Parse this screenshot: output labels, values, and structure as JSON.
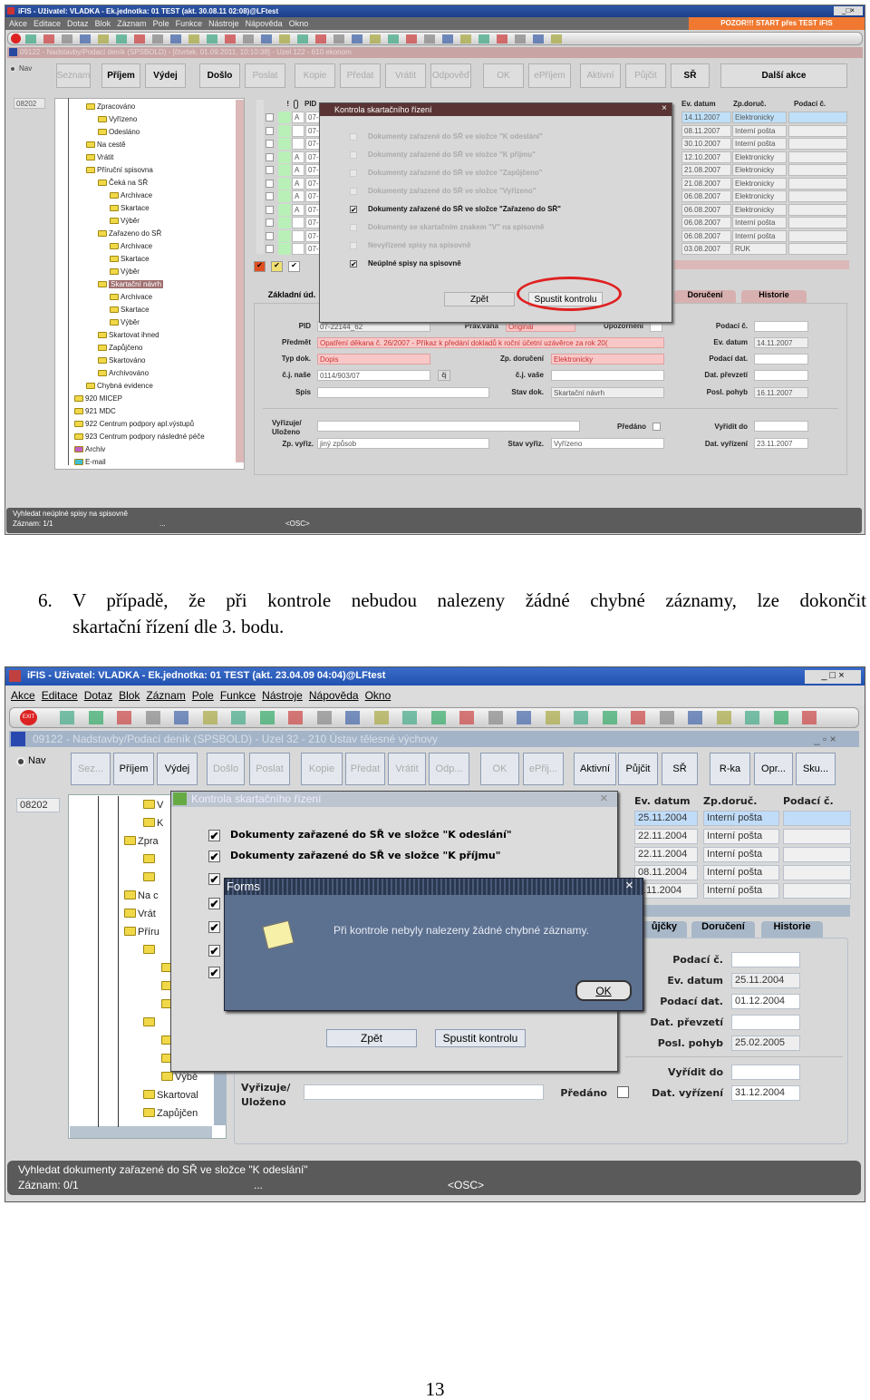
{
  "shot1": {
    "title": "iFIS - Uživatel: VLADKA - Ek.jednotka: 01 TEST (akt. 30.08.11 02:08)@LFtest",
    "menu": [
      "Akce",
      "Editace",
      "Dotaz",
      "Blok",
      "Záznam",
      "Pole",
      "Funkce",
      "Nástroje",
      "Nápověda",
      "Okno"
    ],
    "banner": "POZOR!!!  START přes TEST iFIS",
    "inner_title": "09122 - Nadstavby/Podací deník (SPSBOLD) - [čtvrtek, 01.09.2011, 10:10:38] - Uzel 122 - 610 ekonom",
    "nav_label": "Nav",
    "buttons": [
      {
        "label": "Seznam",
        "enabled": false
      },
      {
        "label": "Příjem",
        "enabled": true
      },
      {
        "label": "Výdej",
        "enabled": true
      },
      {
        "label": "Došlo",
        "enabled": true
      },
      {
        "label": "Poslat",
        "enabled": false
      },
      {
        "label": "Kopie",
        "enabled": false
      },
      {
        "label": "Předat",
        "enabled": false
      },
      {
        "label": "Vrátit",
        "enabled": false
      },
      {
        "label": "Odpověď",
        "enabled": false
      },
      {
        "label": "OK",
        "enabled": false
      },
      {
        "label": "ePříjem",
        "enabled": false
      },
      {
        "label": "Aktivní",
        "enabled": false
      },
      {
        "label": "Půjčit",
        "enabled": false
      },
      {
        "label": "SŘ",
        "enabled": true
      },
      {
        "label": "Další akce",
        "enabled": true
      }
    ],
    "record_field": "08202",
    "tree": [
      {
        "label": "Zpracováno",
        "level": 2
      },
      {
        "label": "Vyřízeno",
        "level": 3
      },
      {
        "label": "Odesláno",
        "level": 3
      },
      {
        "label": "Na cestě",
        "level": 2
      },
      {
        "label": "Vrátit",
        "level": 2
      },
      {
        "label": "Příruční spisovna",
        "level": 2
      },
      {
        "label": "Čeká na SŘ",
        "level": 3
      },
      {
        "label": "Archivace",
        "level": 4
      },
      {
        "label": "Skartace",
        "level": 4
      },
      {
        "label": "Výběr",
        "level": 4
      },
      {
        "label": "Zařazeno do SŘ",
        "level": 3
      },
      {
        "label": "Archivace",
        "level": 4
      },
      {
        "label": "Skartace",
        "level": 4
      },
      {
        "label": "Výběr",
        "level": 4
      },
      {
        "label": "Skartační návrh",
        "level": 3,
        "selected": true
      },
      {
        "label": "Archivace",
        "level": 4
      },
      {
        "label": "Skartace",
        "level": 4
      },
      {
        "label": "Výběr",
        "level": 4
      },
      {
        "label": "Skartovat ihned",
        "level": 3
      },
      {
        "label": "Zapůjčeno",
        "level": 3
      },
      {
        "label": "Skartováno",
        "level": 3
      },
      {
        "label": "Archivováno",
        "level": 3
      },
      {
        "label": "Chybná evidence",
        "level": 2
      },
      {
        "label": "920 MICEP",
        "level": 1
      },
      {
        "label": "921 MDC",
        "level": 1
      },
      {
        "label": "922 Centrum podpory apl.výstupů",
        "level": 1
      },
      {
        "label": "923 Centrum podpory následné péče",
        "level": 1
      },
      {
        "label": "Archiv",
        "level": 1,
        "color": "#c060c0"
      },
      {
        "label": "E-mail",
        "level": 1,
        "color": "#40c0d0"
      }
    ],
    "table": {
      "headers": {
        "excl": "!",
        "pid": "PID",
        "ev_datum": "Ev. datum",
        "zp_doruc": "Zp.doruč.",
        "podaci": "Podací č."
      },
      "rows": [
        {
          "flag": "A",
          "pid": "07-",
          "ev_datum": "14.11.2007",
          "zp_doruc": "Elektronicky",
          "selected": true
        },
        {
          "flag": "",
          "pid": "07-",
          "ev_datum": "08.11.2007",
          "zp_doruc": "Interní pošta"
        },
        {
          "flag": "",
          "pid": "07-",
          "ev_datum": "30.10.2007",
          "zp_doruc": "Interní pošta"
        },
        {
          "flag": "A",
          "pid": "07-",
          "ev_datum": "12.10.2007",
          "zp_doruc": "Elektronicky"
        },
        {
          "flag": "A",
          "pid": "07-",
          "ev_datum": "21.08.2007",
          "zp_doruc": "Elektronicky"
        },
        {
          "flag": "A",
          "pid": "07-",
          "ev_datum": "21.08.2007",
          "zp_doruc": "Elektronicky"
        },
        {
          "flag": "A",
          "pid": "07-",
          "ev_datum": "06.08.2007",
          "zp_doruc": "Elektronicky"
        },
        {
          "flag": "A",
          "pid": "07-",
          "ev_datum": "06.08.2007",
          "zp_doruc": "Elektronicky"
        },
        {
          "flag": "",
          "pid": "07-",
          "ev_datum": "06.08.2007",
          "zp_doruc": "Interní pošta"
        },
        {
          "flag": "",
          "pid": "07-",
          "ev_datum": "06.08.2007",
          "zp_doruc": "Interní pošta"
        },
        {
          "flag": "",
          "pid": "07-",
          "ev_datum": "03.08.2007",
          "zp_doruc": "RUK"
        }
      ]
    },
    "dialog": {
      "title": "Kontrola skartačního řízení",
      "options": [
        {
          "label": "Dokumenty zařazené do SŘ ve složce \"K odeslání\"",
          "checked": false,
          "enabled": false
        },
        {
          "label": "Dokumenty zařazené do SŘ ve složce \"K příjmu\"",
          "checked": false,
          "enabled": false
        },
        {
          "label": "Dokumenty zařazené do SŘ ve složce \"Zapůjčeno\"",
          "checked": false,
          "enabled": false
        },
        {
          "label": "Dokumenty zařazené do SŘ ve složce \"Vyřízeno\"",
          "checked": false,
          "enabled": false
        },
        {
          "label": "Dokumenty zařazené do SŘ ve složce \"Zařazeno do SŘ\"",
          "checked": true,
          "enabled": true
        },
        {
          "label": "Dokumenty se skartačním znakem \"V\" na spisovně",
          "checked": false,
          "enabled": false
        },
        {
          "label": "Nevyřízené spisy na spisovně",
          "checked": false,
          "enabled": false
        },
        {
          "label": "Neúplné spisy na spisovně",
          "checked": true,
          "enabled": true
        }
      ],
      "back": "Zpět",
      "run": "Spustit kontrolu",
      "highlight_color": "#e02020"
    },
    "tabs": [
      "Základní úd.",
      "Doručení",
      "Historie"
    ],
    "form": {
      "pid_label": "PID",
      "pid": "07-22144_62",
      "prav_vaha_label": "Práv.váha",
      "prav_vaha": "Originál",
      "upozorneni_label": "Upozornění",
      "predmet_label": "Předmět",
      "predmet": "Opatření děkana č. 26/2007 - Příkaz k předání dokladů k roční účetní uzávěrce za rok 20(",
      "typ_label": "Typ dok.",
      "typ": "Dopis",
      "zp_doruceni_label": "Zp. doručení",
      "zp_doruceni": "Elektronicky",
      "cj_nase_label": "č.j. naše",
      "cj_nase": "0114/903/07",
      "cj_button": "čj",
      "cj_vase_label": "č.j. vaše",
      "spis_label": "Spis",
      "stav_dok_label": "Stav dok.",
      "stav_dok": "Skartační návrh",
      "podaci_c_label": "Podací č.",
      "ev_datum_label": "Ev. datum",
      "ev_datum": "14.11.2007",
      "podaci_dat_label": "Podací dat.",
      "dat_prevzeti_label": "Dat. převzetí",
      "posl_pohyb_label": "Posl. pohyb",
      "posl_pohyb": "16.11.2007",
      "vyrizuje_label": "Vyřizuje/",
      "ulozeno_label": "Uloženo",
      "predano_label": "Předáno",
      "vyridit_do_label": "Vyřídit do",
      "zp_vyriz_label": "Zp. vyřiz.",
      "zp_vyriz": "jiný způsob",
      "stav_vyriz_label": "Stav vyřiz.",
      "stav_vyriz": "Vyřízeno",
      "dat_vyrizeni_label": "Dat. vyřízení",
      "dat_vyrizeni": "23.11.2007"
    },
    "status": {
      "message": "Vyhledat neúplné spisy na spisovně",
      "record": "Záznam: 1/1",
      "dots": "...",
      "osc": "<OSC>"
    }
  },
  "caption": {
    "number": "6.",
    "line1": "V případě, že při kontrole nebudou nalezeny žádné chybné záznamy, lze dokončit",
    "line2": "skartační řízení dle 3. bodu."
  },
  "shot2": {
    "title": "iFIS - Uživatel: VLADKA - Ek.jednotka: 01 TEST (akt. 23.04.09 04:04)@LFtest",
    "menu": [
      "Akce",
      "Editace",
      "Dotaz",
      "Blok",
      "Záznam",
      "Pole",
      "Funkce",
      "Nástroje",
      "Nápověda",
      "Okno"
    ],
    "inner_title": "09122 - Nadstavby/Podací deník (SPSBOLD) - Uzel 32 - 210 Ústav tělesné výchovy",
    "nav_label": "Nav",
    "buttons": [
      {
        "label": "Sez...",
        "enabled": false
      },
      {
        "label": "Příjem",
        "enabled": true
      },
      {
        "label": "Výdej",
        "enabled": true
      },
      {
        "label": "Došlo",
        "enabled": false
      },
      {
        "label": "Poslat",
        "enabled": false
      },
      {
        "label": "Kopie",
        "enabled": false
      },
      {
        "label": "Předat",
        "enabled": false
      },
      {
        "label": "Vrátit",
        "enabled": false
      },
      {
        "label": "Odp...",
        "enabled": false
      },
      {
        "label": "OK",
        "enabled": false
      },
      {
        "label": "ePřij...",
        "enabled": false
      },
      {
        "label": "Aktivní",
        "enabled": true
      },
      {
        "label": "Půjčit",
        "enabled": true
      },
      {
        "label": "SŘ",
        "enabled": true
      },
      {
        "label": "R-ka",
        "enabled": true
      },
      {
        "label": "Opr...",
        "enabled": true
      },
      {
        "label": "Sku...",
        "enabled": true
      }
    ],
    "record_field": "08202",
    "tree": [
      {
        "label": "V",
        "level": 3
      },
      {
        "label": "K",
        "level": 3
      },
      {
        "label": "Zpra",
        "level": 2
      },
      {
        "label": "",
        "level": 3
      },
      {
        "label": "",
        "level": 3
      },
      {
        "label": "Na c",
        "level": 2
      },
      {
        "label": "Vrát",
        "level": 2
      },
      {
        "label": "Příru",
        "level": 2
      },
      {
        "label": "",
        "level": 3
      },
      {
        "label": "",
        "level": 4
      },
      {
        "label": "",
        "level": 4
      },
      {
        "label": "",
        "level": 4
      },
      {
        "label": "",
        "level": 3
      },
      {
        "label": "",
        "level": 4
      },
      {
        "label": "",
        "level": 4
      },
      {
        "label": "Výbě",
        "level": 4
      },
      {
        "label": "Skartoval",
        "level": 3
      },
      {
        "label": "Zapůjčen",
        "level": 3
      }
    ],
    "table": {
      "headers": {
        "ev_datum": "Ev. datum",
        "zp_doruc": "Zp.doruč.",
        "podaci": "Podací č."
      },
      "rows": [
        {
          "ev_datum": "25.11.2004",
          "zp_doruc": "Interní pošta",
          "selected": true
        },
        {
          "ev_datum": "22.11.2004",
          "zp_doruc": "Interní pošta"
        },
        {
          "ev_datum": "22.11.2004",
          "zp_doruc": "Interní pošta"
        },
        {
          "ev_datum": "08.11.2004",
          "zp_doruc": "Interní pošta"
        },
        {
          "ev_datum": "4.11.2004",
          "zp_doruc": "Interní pošta"
        }
      ]
    },
    "dialog": {
      "title": "Kontrola skartačního řízení",
      "options": [
        {
          "label": "Dokumenty zařazené do SŘ ve složce \"K odeslání\"",
          "checked": true
        },
        {
          "label": "Dokumenty zařazené do SŘ ve složce \"K příjmu\"",
          "checked": true
        },
        {
          "label": "",
          "checked": true
        },
        {
          "label": "",
          "checked": true
        },
        {
          "label": "",
          "checked": true
        },
        {
          "label": "",
          "checked": true
        },
        {
          "label": "",
          "checked": true
        }
      ],
      "back": "Zpět",
      "run": "Spustit kontrolu"
    },
    "alert": {
      "title": "Forms",
      "message": "Při kontrole nebyly nalezeny žádné chybné záznamy.",
      "ok": "OK",
      "icon": "note-icon"
    },
    "tabs": [
      "ůjčky",
      "Doručení",
      "Historie"
    ],
    "form": {
      "podaci_c_label": "Podací č.",
      "ev_datum_label": "Ev. datum",
      "ev_datum": "25.11.2004",
      "podaci_dat_label": "Podací dat.",
      "podaci_dat": "01.12.2004",
      "dat_prevzeti_label": "Dat. převzetí",
      "posl_pohyb_label": "Posl. pohyb",
      "posl_pohyb": "25.02.2005",
      "vyridit_do_label": "Vyřídit do",
      "dat_vyrizeni_label": "Dat. vyřízení",
      "dat_vyrizeni": "31.12.2004",
      "vyrizuje_label": "Vyřizuje/",
      "ulozeno_label": "Uloženo",
      "predano_label": "Předáno"
    },
    "status": {
      "message": "Vyhledat dokumenty zařazené do SŘ ve složce \"K odeslání\"",
      "record": "Záznam: 0/1",
      "dots": "...",
      "osc": "<OSC>"
    }
  },
  "page_number": "13"
}
